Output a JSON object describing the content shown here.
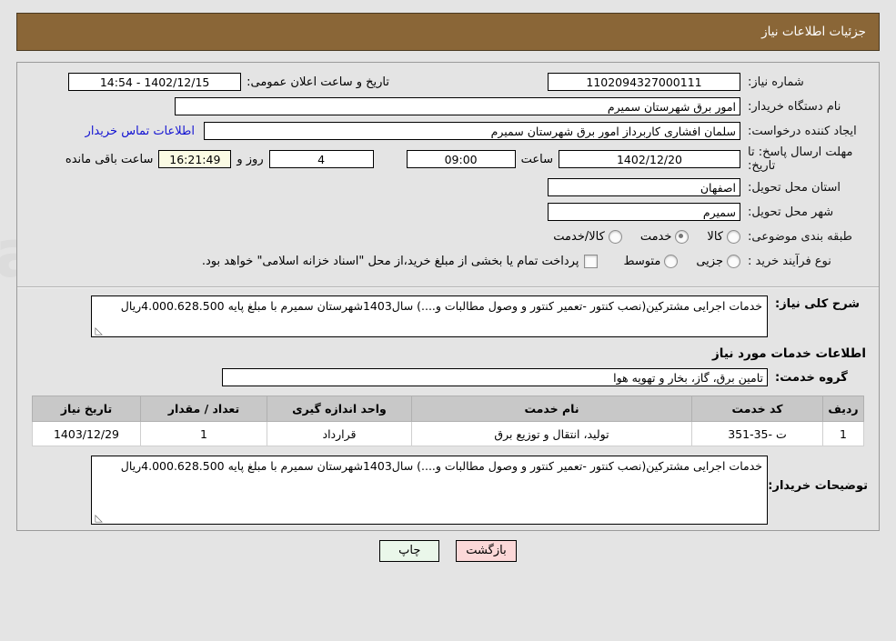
{
  "header": {
    "title": "جزئیات اطلاعات نیاز"
  },
  "form": {
    "need_no_label": "شماره نیاز:",
    "need_no_value": "1102094327000111",
    "public_announce_label": "تاریخ و ساعت اعلان عمومی:",
    "public_announce_value": "1402/12/15 - 14:54",
    "buyer_org_label": "نام دستگاه خریدار:",
    "buyer_org_value": "امور برق شهرستان سمیرم",
    "creator_label": "ایجاد کننده درخواست:",
    "creator_value": "سلمان  افشاری کاربرداز امور برق شهرستان سمیرم",
    "contact_link": "اطلاعات تماس خریدار",
    "deadline_label": "مهلت ارسال پاسخ: تا تاریخ:",
    "deadline_date": "1402/12/20",
    "hour_label": "ساعت",
    "deadline_time": "09:00",
    "days_value": "4",
    "days_label": "روز و",
    "countdown_value": "16:21:49",
    "remaining_label": "ساعت باقی مانده",
    "province_label": "استان محل تحویل:",
    "province_value": "اصفهان",
    "city_label": "شهر محل تحویل:",
    "city_value": "سمیرم",
    "category_label": "طبقه بندی موضوعی:",
    "category_options": [
      {
        "label": "کالا",
        "checked": false
      },
      {
        "label": "خدمت",
        "checked": true
      },
      {
        "label": "کالا/خدمت",
        "checked": false
      }
    ],
    "process_label": "نوع فرآیند خرید :",
    "process_options": [
      {
        "label": "جزیی",
        "checked": false
      },
      {
        "label": "متوسط",
        "checked": false
      }
    ],
    "treasury_checkbox_label": "پرداخت تمام یا بخشی از مبلغ خرید،از محل \"اسناد خزانه اسلامی\" خواهد بود."
  },
  "need_description": {
    "label": "شرح کلی نیاز:",
    "value": "خدمات اجرایی مشترکین(نصب کنتور -تعمیر کنتور و وصول مطالبات و....) سال1403شهرستان سمیرم با مبلغ پایه 4.000.628.500ریال"
  },
  "services": {
    "section_title": "اطلاعات خدمات مورد نیاز",
    "group_label": "گروه خدمت:",
    "group_value": "تامین برق، گاز، بخار و تهویه هوا",
    "columns": [
      "ردیف",
      "کد خدمت",
      "نام خدمت",
      "واحد اندازه گیری",
      "تعداد / مقدار",
      "تاریخ نیاز"
    ],
    "rows": [
      {
        "radif": "1",
        "code": "ت -35-351",
        "name": "تولید، انتقال و توزیع برق",
        "unit": "قرارداد",
        "qty": "1",
        "date": "1403/12/29"
      }
    ]
  },
  "buyer_note": {
    "label": "توضیحات خریدار:",
    "value": "خدمات اجرایی مشترکین(نصب کنتور -تعمیر کنتور و وصول مطالبات و....) سال1403شهرستان سمیرم با مبلغ پایه 4.000.628.500ریال"
  },
  "footer": {
    "print_label": "چاپ",
    "back_label": "بازگشت"
  },
  "colors": {
    "header_bg": "#8a6637",
    "link": "#1414d2",
    "print_btn": "#eaf7ea",
    "back_btn": "#fbd8d8",
    "countdown_bg": "#fbfbe4"
  }
}
